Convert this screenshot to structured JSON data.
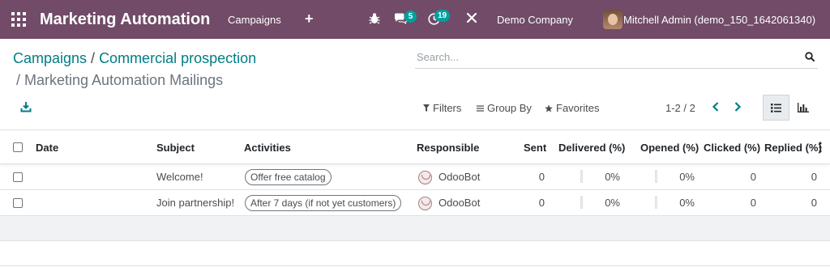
{
  "navbar": {
    "app_title": "Marketing Automation",
    "menu_campaigns": "Campaigns",
    "menu_plus": "+",
    "messages_count": "5",
    "activities_count": "19",
    "company": "Demo Company",
    "user": "Mitchell Admin (demo_150_1642061340)",
    "brand_color": "#714b67",
    "badge_color": "#00a09d"
  },
  "breadcrumb": {
    "part1": "Campaigns",
    "sep1": " / ",
    "part2": "Commercial prospection",
    "line2": "/ Marketing Automation Mailings"
  },
  "search": {
    "placeholder": "Search..."
  },
  "filters": {
    "filters_label": "Filters",
    "groupby_label": "Group By",
    "favorites_label": "Favorites"
  },
  "pager": {
    "value": "1-2 / 2"
  },
  "table": {
    "headers": {
      "date": "Date",
      "subject": "Subject",
      "activities": "Activities",
      "responsible": "Responsible",
      "sent": "Sent",
      "delivered": "Delivered (%)",
      "opened": "Opened (%)",
      "clicked": "Clicked (%)",
      "replied": "Replied (%)"
    },
    "rows": [
      {
        "date": "",
        "subject": "Welcome!",
        "activity": "Offer free catalog",
        "responsible": "OdooBot",
        "sent": "0",
        "delivered": "0%",
        "opened": "0%",
        "clicked": "0",
        "replied": "0"
      },
      {
        "date": "",
        "subject": "Join partnership!",
        "activity": "After 7 days (if not yet customers)",
        "responsible": "OdooBot",
        "sent": "0",
        "delivered": "0%",
        "opened": "0%",
        "clicked": "0",
        "replied": "0"
      }
    ]
  },
  "icons": {
    "apps": "apps-grid-icon",
    "bug": "bug-icon",
    "chat": "chat-icon",
    "clock": "clock-icon",
    "tools": "tools-icon",
    "search": "search-icon",
    "download": "download-icon",
    "filter": "filter-icon",
    "groupby": "list-lines-icon",
    "favorites": "star-icon",
    "prev": "chevron-left-icon",
    "next": "chevron-right-icon",
    "list_view": "list-view-icon",
    "graph_view": "bar-chart-icon"
  }
}
